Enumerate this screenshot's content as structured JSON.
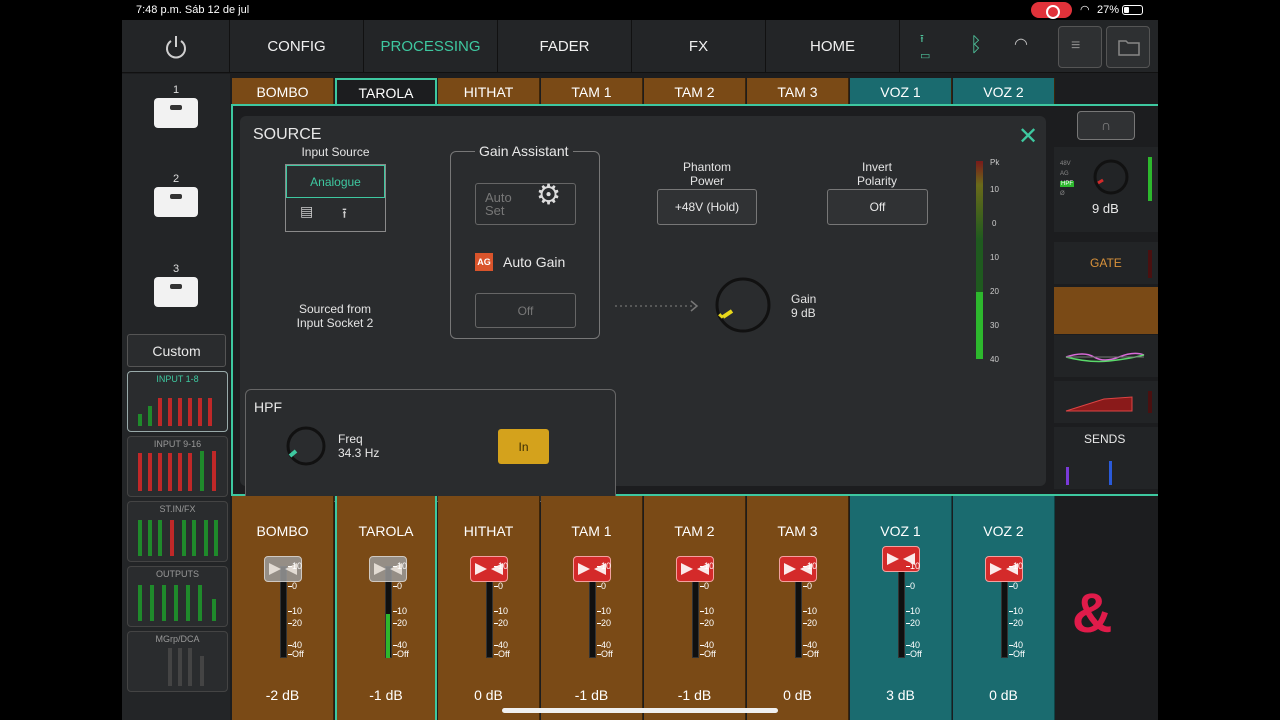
{
  "statusbar": {
    "time": "7:48 p.m.   Sáb 12 de jul",
    "battery": "27%"
  },
  "nav": {
    "tabs": [
      "CONFIG",
      "PROCESSING",
      "FADER",
      "FX",
      "HOME"
    ]
  },
  "sidebar": {
    "layers": [
      "1",
      "2",
      "3"
    ],
    "custom": "Custom",
    "banks": [
      "INPUT 1-8",
      "INPUT 9-16",
      "ST.IN/FX",
      "OUTPUTS",
      "MGrp/DCA"
    ]
  },
  "channel_tabs": [
    "BOMBO",
    "TAROLA",
    "HITHAT",
    "TAM 1",
    "TAM 2",
    "TAM 3",
    "VOZ 1",
    "VOZ 2"
  ],
  "source": {
    "title": "SOURCE",
    "input_source_label": "Input Source",
    "input_source_value": "Analogue",
    "sourced_from": "Sourced from",
    "socket": "Input Socket 2",
    "gain_assistant": "Gain Assistant",
    "auto_set_1": "Auto",
    "auto_set_2": "Set",
    "ag_icon": "AG",
    "auto_gain": "Auto Gain",
    "auto_gain_state": "Off",
    "phantom_label_1": "Phantom",
    "phantom_label_2": "Power",
    "phantom_value": "+48V (Hold)",
    "invert_label_1": "Invert",
    "invert_label_2": "Polarity",
    "invert_value": "Off",
    "gain_label": "Gain",
    "gain_value": "9 dB",
    "meter_scale": [
      "Pk",
      "10",
      "0",
      "10",
      "20",
      "30",
      "40"
    ]
  },
  "hpf": {
    "title": "HPF",
    "freq_label": "Freq",
    "freq_value": "34.3 Hz",
    "in_label": "In"
  },
  "right_strip": {
    "gain": "9 dB",
    "gate": "GATE",
    "sends": "SENDS",
    "mini_labels": [
      "48V",
      "AG",
      "HPF",
      "Ø"
    ]
  },
  "fader_scale": [
    "10",
    "0",
    "10",
    "20",
    "40",
    "Off"
  ],
  "strips": [
    {
      "name": "BOMBO",
      "value": "-2 dB"
    },
    {
      "name": "TAROLA",
      "value": "-1 dB"
    },
    {
      "name": "HITHAT",
      "value": "0 dB"
    },
    {
      "name": "TAM 1",
      "value": "-1 dB"
    },
    {
      "name": "TAM 2",
      "value": "-1 dB"
    },
    {
      "name": "TAM 3",
      "value": "0 dB"
    },
    {
      "name": "VOZ 1",
      "value": "3 dB"
    },
    {
      "name": "VOZ 2",
      "value": "0 dB"
    }
  ],
  "logo": "&"
}
